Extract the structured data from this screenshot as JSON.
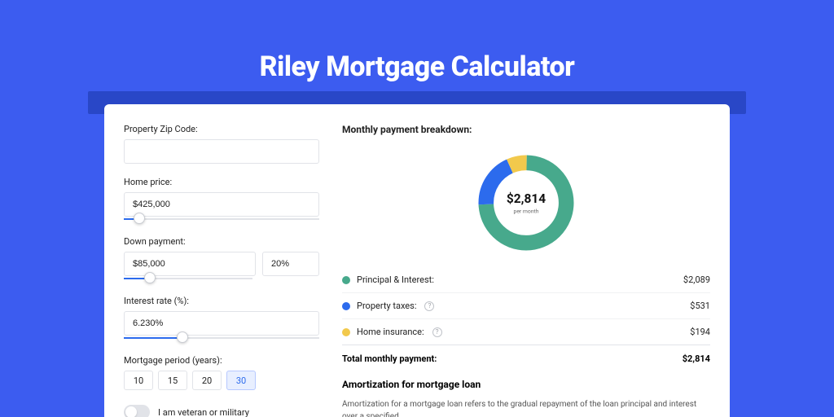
{
  "title": "Riley Mortgage Calculator",
  "form": {
    "zip_label": "Property Zip Code:",
    "zip_value": "",
    "price_label": "Home price:",
    "price_value": "$425,000",
    "price_slider_pct": 8,
    "down_label": "Down payment:",
    "down_value": "$85,000",
    "down_pct": "20%",
    "down_slider_pct": 20,
    "rate_label": "Interest rate (%):",
    "rate_value": "6.230%",
    "rate_slider_pct": 30,
    "period_label": "Mortgage period (years):",
    "period_options": [
      "10",
      "15",
      "20",
      "30"
    ],
    "period_selected": "30",
    "veteran_label": "I am veteran or military"
  },
  "breakdown": {
    "title": "Monthly payment breakdown:",
    "center_amount": "$2,814",
    "center_sub": "per month",
    "items": [
      {
        "label": "Principal & Interest:",
        "value": "$2,089",
        "color": "green",
        "info": false
      },
      {
        "label": "Property taxes:",
        "value": "$531",
        "color": "blue",
        "info": true
      },
      {
        "label": "Home insurance:",
        "value": "$194",
        "color": "yellow",
        "info": true
      }
    ],
    "total_label": "Total monthly payment:",
    "total_value": "$2,814"
  },
  "amort": {
    "title": "Amortization for mortgage loan",
    "text": "Amortization for a mortgage loan refers to the gradual repayment of the loan principal and interest over a specified"
  },
  "chart_data": {
    "type": "pie",
    "title": "Monthly payment breakdown",
    "series": [
      {
        "name": "Principal & Interest",
        "value": 2089,
        "color": "#47a98c"
      },
      {
        "name": "Property taxes",
        "value": 531,
        "color": "#2c6bed"
      },
      {
        "name": "Home insurance",
        "value": 194,
        "color": "#f2c94c"
      }
    ],
    "total": 2814
  }
}
